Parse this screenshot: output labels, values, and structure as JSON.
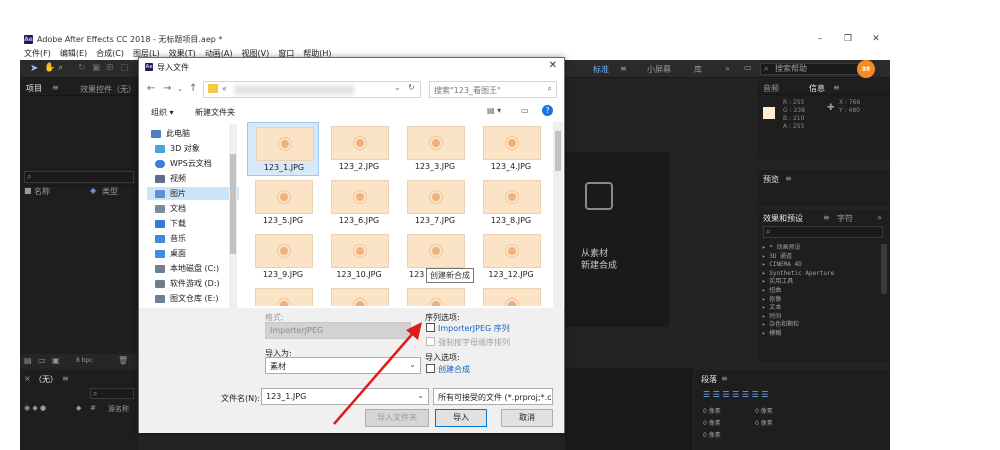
{
  "app": {
    "title": "Adobe After Effects CC 2018 - 无标题项目.aep *",
    "logo": "Ae",
    "menu": [
      "文件(F)",
      "编辑(E)",
      "合成(C)",
      "图层(L)",
      "效果(T)",
      "动画(A)",
      "视图(V)",
      "窗口",
      "帮助(H)"
    ],
    "panels": {
      "project": "项目",
      "effect_controls": "效果控件（无）",
      "col_name": "名称",
      "col_type": "类型",
      "bpc": "8 bpc",
      "timeline_none": "（无）",
      "layer_name": "源名称",
      "workspace_standard": "标准",
      "workspace_small": "小屏幕",
      "workspace_lib": "库",
      "search_help": "搜索帮助",
      "audio": "音频",
      "info": "信息",
      "info_values": [
        "R : 255",
        "G : 238",
        "B : 210",
        "A : 255"
      ],
      "info_xy": [
        "X : 766",
        "Y : 480"
      ],
      "preview": "预览",
      "effects_presets": "效果和预设",
      "character": "字符",
      "effects_list": [
        "▸ * 动画预设",
        "▸ 3D 通道",
        "▸ CINEMA 4D",
        "▸ Synthetic Aperture",
        "▸ 实用工具",
        "▸ 扭曲",
        "▸ 抠像",
        "▸ 文本",
        "▸ 时间",
        "▸ 杂色和颗粒",
        "▸ 模糊"
      ],
      "paragraph": "段落",
      "para_values": [
        "0 像素",
        "0 像素",
        "0 像素",
        "0 像素",
        "0 像素"
      ],
      "comp_hint_1": "从素材",
      "comp_hint_2": "新建合成",
      "orange_badge": "88"
    }
  },
  "dialog": {
    "title": "导入文件",
    "path_crumb": "«",
    "search_placeholder": "搜索\"123_看图王\"",
    "organize": "组织 ▾",
    "new_folder": "新建文件夹",
    "sidebar": [
      {
        "label": "此电脑",
        "color": "#4a7fc1"
      },
      {
        "label": "3D 对象",
        "color": "#4aa3df"
      },
      {
        "label": "WPS云文档",
        "color": "#3b7de0"
      },
      {
        "label": "视频",
        "color": "#5a6d8c"
      },
      {
        "label": "图片",
        "color": "#5d8fd6"
      },
      {
        "label": "文档",
        "color": "#7a8aa0"
      },
      {
        "label": "下载",
        "color": "#2f7be0"
      },
      {
        "label": "音乐",
        "color": "#3a8ad8"
      },
      {
        "label": "桌面",
        "color": "#3c8ee6"
      },
      {
        "label": "本地磁盘 (C:)",
        "color": "#6f7f90"
      },
      {
        "label": "软件游戏 (D:)",
        "color": "#6f7f90"
      },
      {
        "label": "图文仓库 (E:)",
        "color": "#6f7f90"
      }
    ],
    "files": [
      "123_1.JPG",
      "123_2.JPG",
      "123_3.JPG",
      "123_4.JPG",
      "123_5.JPG",
      "123_6.JPG",
      "123_7.JPG",
      "123_8.JPG",
      "123_9.JPG",
      "123_10.JPG",
      "123",
      "123_12.JPG",
      "",
      "",
      "",
      ""
    ],
    "tooltip": "创建新合成",
    "format_label": "格式:",
    "format_value": "ImporterJPEG",
    "import_as_label": "导入为:",
    "import_as_value": "素材",
    "sequence_options": "序列选项:",
    "importer_sequence": "ImporterJPEG 序列",
    "force_alpha": "强制按字母顺序排列",
    "import_options": "导入选项:",
    "create_comp": "创建合成",
    "filename_label": "文件名(N):",
    "filename_value": "123_1.JPG",
    "filetype_value": "所有可接受的文件 (*.prproj;*.c",
    "import_folder": "导入文件夹",
    "import_btn": "导入",
    "cancel_btn": "取消"
  }
}
